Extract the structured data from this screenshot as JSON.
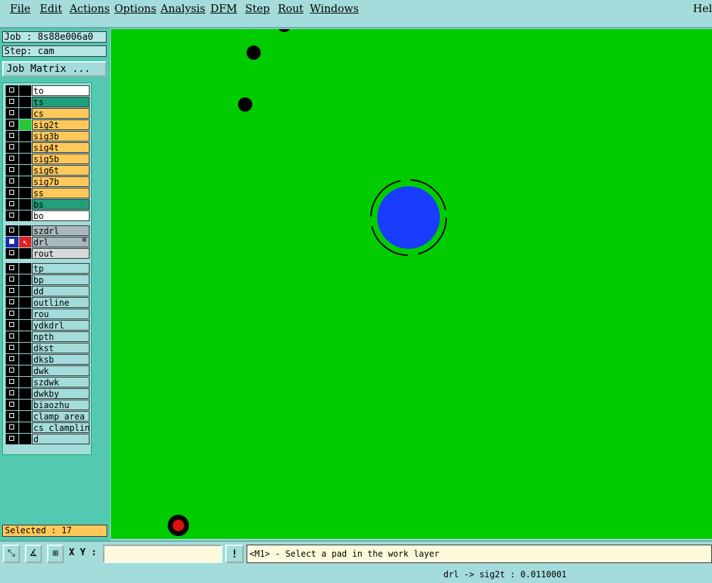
{
  "menu": [
    "File",
    "Edit",
    "Actions",
    "Options",
    "Analysis",
    "DFM",
    "Step",
    "Rout",
    "Windows"
  ],
  "help_label": "Hel",
  "job_label": "Job : 8s88e006a0",
  "step_label": "Step: cam",
  "job_matrix_label": "Job Matrix ...",
  "layers_board": [
    {
      "name": "to",
      "color": "white"
    },
    {
      "name": "ts",
      "color": "teal"
    },
    {
      "name": "cs",
      "color": "orange"
    },
    {
      "name": "sig2t",
      "color": "orange",
      "affected": "green"
    },
    {
      "name": "sig3b",
      "color": "orange"
    },
    {
      "name": "sig4t",
      "color": "orange"
    },
    {
      "name": "sig5b",
      "color": "orange"
    },
    {
      "name": "sig6t",
      "color": "orange"
    },
    {
      "name": "sig7b",
      "color": "orange"
    },
    {
      "name": "ss",
      "color": "orange"
    },
    {
      "name": "bs",
      "color": "teal"
    },
    {
      "name": "bo",
      "color": "white"
    }
  ],
  "layers_drill": [
    {
      "name": "szdrl",
      "color": "grey"
    },
    {
      "name": "drl",
      "color": "grey",
      "active": true,
      "marker": "⊞"
    },
    {
      "name": "rout",
      "color": "lgrey"
    }
  ],
  "layers_misc": [
    "tp",
    "bp",
    "dd",
    "outline",
    "rou",
    "ydkdrl",
    "npth",
    "dkst",
    "dksb",
    "dwk",
    "szdwk",
    "dwkby",
    "biaozhu",
    "clamp_area",
    "cs_clampline",
    "d"
  ],
  "selected_label": "Selected : 17",
  "xy_label": "X Y :",
  "xy_value": "",
  "warn_symbol": "!",
  "prompt_text": "<M1> - Select a pad in the work layer",
  "status_text": "drl -> sig2t : 0.0110001",
  "colors": {
    "canvas": "#00cc00",
    "pad_blue": "#1a3cff",
    "pad_red": "#e01010"
  }
}
